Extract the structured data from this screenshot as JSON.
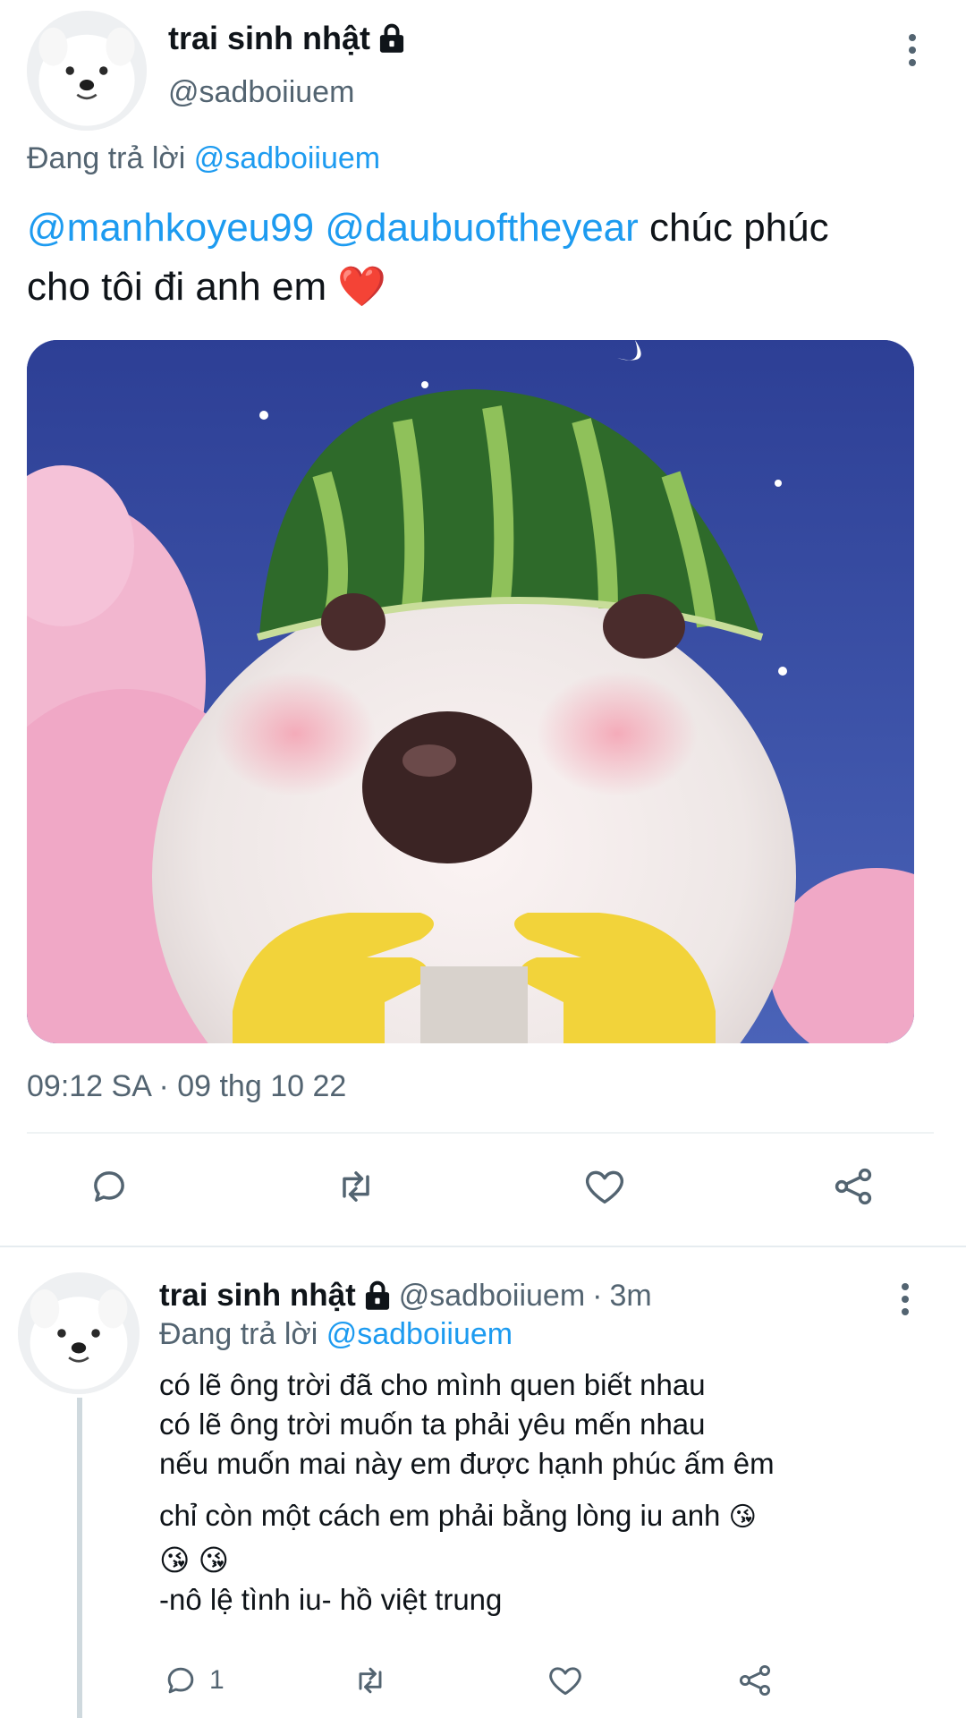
{
  "tweet": {
    "author": {
      "name": "trai sinh nhật",
      "handle": "@sadboiiuem",
      "protected": true
    },
    "replying_label": "Đang trả lời",
    "replying_to": "@sadboiiuem",
    "text": {
      "mention1": "@manhkoyeu99",
      "mention2": "@daubuoftheyear",
      "rest_line1": " chúc phúc",
      "line2": "cho tôi đi anh em",
      "emoji": "❤️"
    },
    "timestamp": "09:12 SA · 09 thg 10 22",
    "actions": {
      "reply_count": "",
      "retweet_count": "",
      "like_count": ""
    }
  },
  "reply": {
    "author": {
      "name": "trai sinh nhật",
      "handle": "@sadboiiuem",
      "separator": "·",
      "time": "3m"
    },
    "replying_label": "Đang trả lời",
    "replying_to": "@sadboiiuem",
    "lines": [
      "có lẽ ông trời đã cho mình quen biết nhau",
      "có lẽ ông trời muốn ta phải yêu mến nhau",
      "nếu muốn mai này em được hạnh phúc ấm êm",
      "chỉ còn một cách em phải bằng lòng iu anh"
    ],
    "emoji_inline": "😘",
    "emoji_line": "😘 😘",
    "signature": "-nô lệ tình iu- hồ việt trung",
    "actions": {
      "reply_count": "1"
    }
  },
  "colors": {
    "accent": "#1d9bf0",
    "text": "#0f1419",
    "muted": "#536471",
    "divider": "#eff3f4"
  },
  "icons": [
    "lock-icon",
    "more-icon",
    "reply-icon",
    "retweet-icon",
    "like-icon",
    "share-icon"
  ]
}
